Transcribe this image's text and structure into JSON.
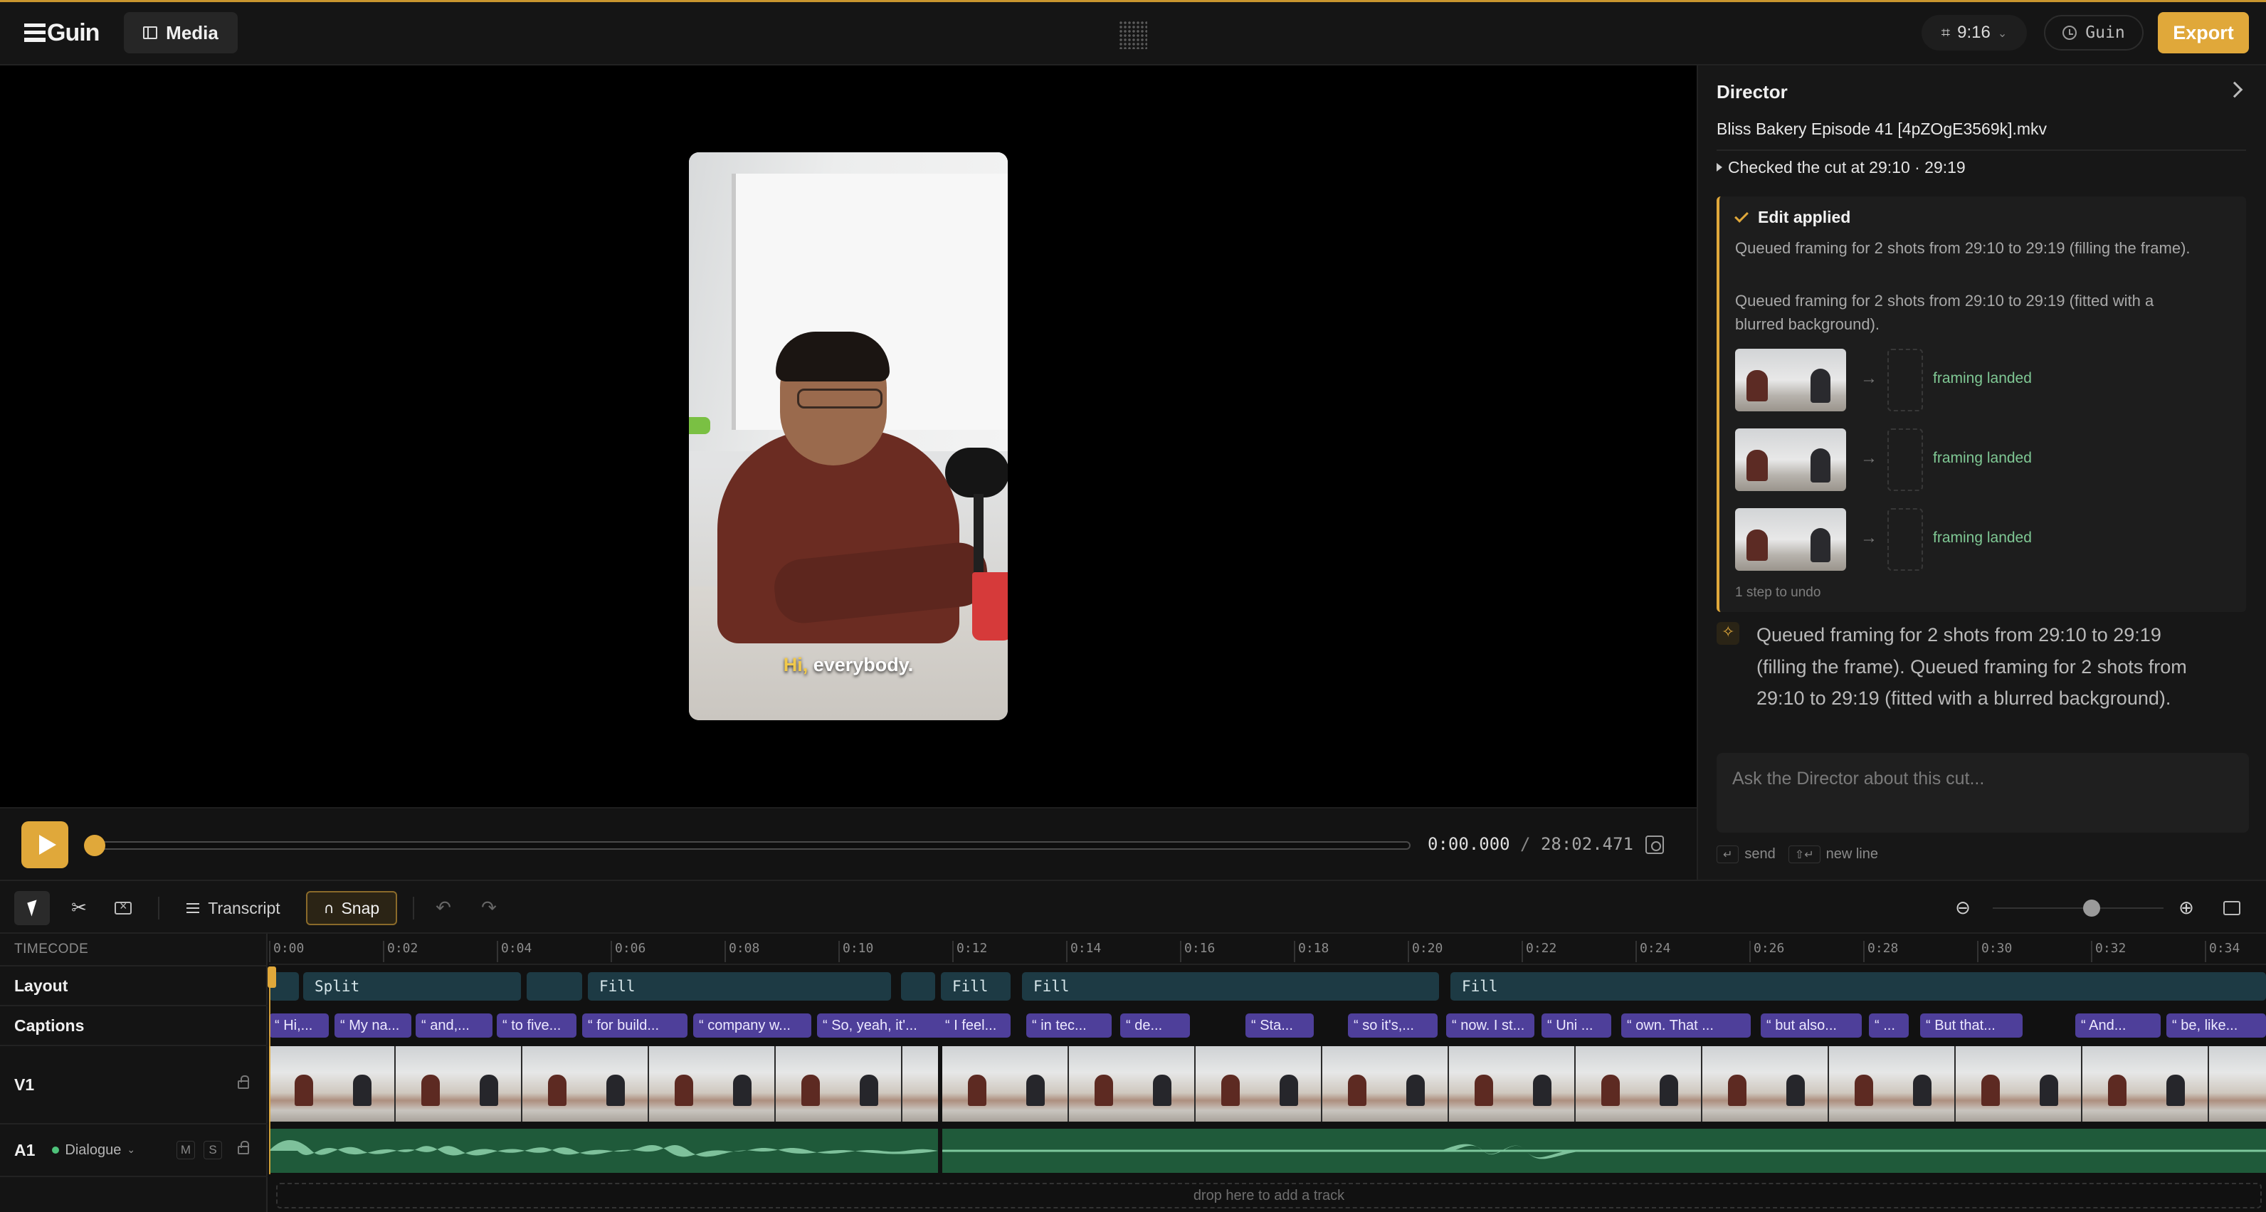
{
  "app": {
    "logo_text": "Guin",
    "media_label": "Media",
    "aspect_ratio": "9:16",
    "guin_button": "Guin",
    "export_label": "Export"
  },
  "preview": {
    "caption_highlight": "Hi,",
    "caption_rest": " everybody."
  },
  "playback": {
    "current_time": "0:00.000",
    "separator": "/",
    "total_time": "28:02.471",
    "progress": 0.0
  },
  "director": {
    "title": "Director",
    "file_name": "Bliss Bakery Episode 41 [4pZOgE3569k].mkv",
    "checked_text": "Checked the cut at 29:10 · 29:19",
    "edit_applied": "Edit applied",
    "edit_lines": [
      "Queued framing for 2 shots from 29:10 to 29:19 (filling the frame).",
      "Queued framing for 2 shots from 29:10 to 29:19 (fitted with a blurred background)."
    ],
    "framing_rows": [
      {
        "arrow": "→",
        "status": "framing landed"
      },
      {
        "arrow": "→",
        "status": "framing landed"
      },
      {
        "arrow": "→",
        "status": "framing landed"
      }
    ],
    "undo_note": "1 step to undo",
    "message": "Queued framing for 2 shots from 29:10 to 29:19 (filling the frame). Queued framing for 2 shots from 29:10 to 29:19 (fitted with a blurred background).",
    "ask_placeholder": "Ask the Director about this cut...",
    "hint_send_key": "↵",
    "hint_send": "send",
    "hint_newline_key": "⇧↵",
    "hint_newline": "new line"
  },
  "toolbar": {
    "transcript_label": "Transcript",
    "snap_label": "Snap",
    "cut_icon": "✂",
    "undo_icon": "↶",
    "redo_icon": "↷",
    "zoom_out_icon": "⊖",
    "zoom_in_icon": "⊕",
    "zoom_level": 0.58
  },
  "timeline": {
    "timecode_label": "TIMECODE",
    "ticks": [
      "0:00",
      "0:02",
      "0:04",
      "0:06",
      "0:08",
      "0:10",
      "0:12",
      "0:14",
      "0:16",
      "0:18",
      "0:20",
      "0:22",
      "0:24",
      "0:26",
      "0:28",
      "0:30",
      "0:32",
      "0:34"
    ],
    "tracks": {
      "layout": "Layout",
      "captions": "Captions",
      "v1": "V1",
      "a1": "A1",
      "a1_role": "Dialogue",
      "mute": "M",
      "solo": "S"
    },
    "layout_clips": [
      "",
      "Split",
      "",
      "Fill",
      "",
      "Fill",
      "Fill",
      "Fill"
    ],
    "caption_clips": [
      "“ Hi,...",
      "“ My na...",
      "“ and,...",
      "“ to five...",
      "“ for build...",
      "“ company w...",
      "“ So, yeah, it'...",
      "“ I feel...",
      "“ in tec...",
      "“ de...",
      "“ Sta...",
      "“ so it's,...",
      "“ now. I st...",
      "“ Uni ...",
      "“ own. That ...",
      "“ but also...",
      "“ ...",
      "“ But that...",
      "“ And...",
      "“ be, like..."
    ],
    "drop_hint": "drop here to add a track"
  }
}
